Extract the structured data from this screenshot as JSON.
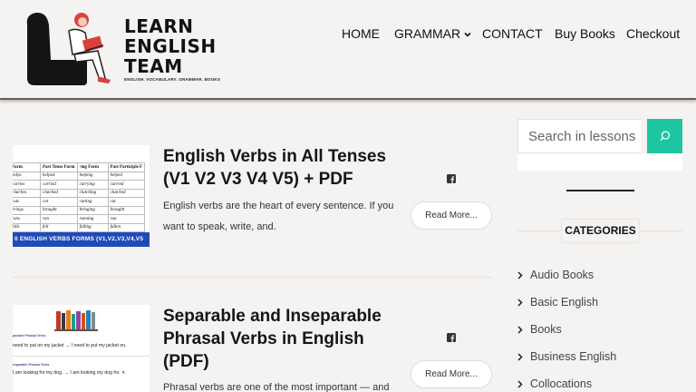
{
  "site": {
    "logo_lines": [
      "LEARN",
      "ENGLISH",
      "TEAM"
    ],
    "tagline": "ENGLISH. VOCABULARY. GRAMMAR. BOOKS"
  },
  "nav": {
    "items": [
      "HOME",
      "GRAMMAR",
      "CONTACT",
      "Buy Books",
      "Checkout"
    ]
  },
  "posts": [
    {
      "title": "English Verbs in All Tenses (V1 V2 V3 V4 V5) + PDF",
      "excerpt": "English verbs are the heart of every sentence. If you want to speak, write, and.",
      "read_more": "Read More...",
      "thumb": {
        "headers": [
          "Form",
          "Past Tense Form",
          "-ing Form",
          "Past Participle F"
        ],
        "rows": [
          [
            "helps",
            "helped",
            "helping",
            "helped"
          ],
          [
            "carries",
            "carried",
            "carrying",
            "carried"
          ],
          [
            "clutches",
            "clutched",
            "clutching",
            "clutched"
          ],
          [
            "cuts",
            "cut",
            "cutting",
            "cut"
          ],
          [
            "brings",
            "brought",
            "bringing",
            "brought"
          ],
          [
            "runs",
            "ran",
            "running",
            "run"
          ],
          [
            "falls",
            "fell",
            "falling",
            "fallen"
          ],
          [
            "drinks",
            "drank",
            "drinking",
            "drank"
          ]
        ],
        "band": "0 ENGLISH VERBS FORMS (V1,V2,V3,V4,V5"
      }
    },
    {
      "title": "Separable and Inseparable Phrasal Verbs in English (PDF)",
      "excerpt": "Phrasal verbs are one of the most important — and",
      "read_more": "Read More...",
      "thumb": {
        "label1": "parable Phrasal Verbs",
        "line1": "need to put on my jacket → I need to put my jacket on.",
        "label2": "separable Phrasal Verbs",
        "line2": "I am looking for my dog. → I am looking my dog for. ✕"
      }
    }
  ],
  "sidebar": {
    "search_placeholder": "Search in lessons",
    "categories_title": "CATEGORIES",
    "categories": [
      "Audio Books",
      "Basic English",
      "Books",
      "Business English",
      "Collocations"
    ]
  },
  "colors": {
    "accent": "#1ec6a0",
    "thumb_band": "#1f4bb8"
  }
}
